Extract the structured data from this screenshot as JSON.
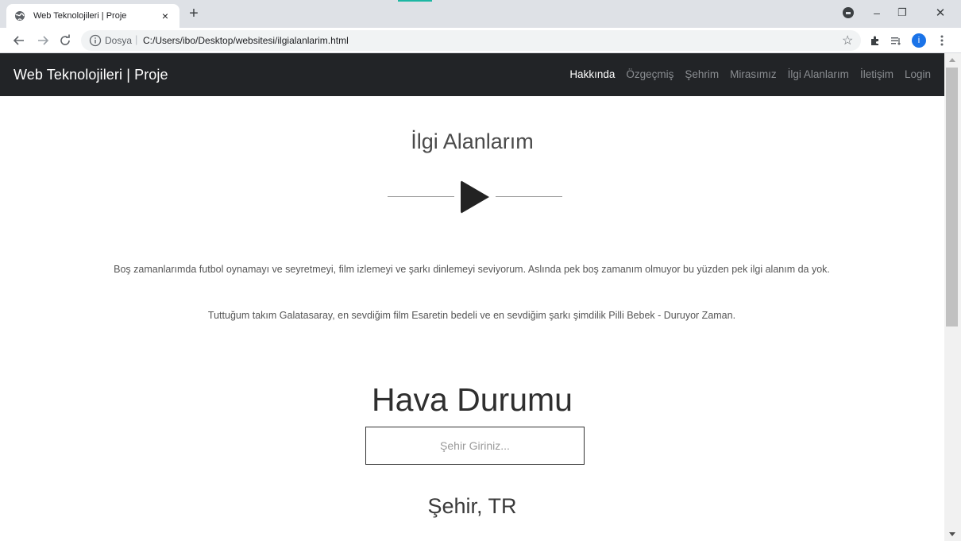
{
  "browser": {
    "tab_title": "Web Teknolojileri | Proje",
    "tab_close": "×",
    "new_tab": "+",
    "address": {
      "scheme_label": "Dosya",
      "separator": "|",
      "url": "C:/Users/ibo/Desktop/websitesi/ilgialanlarim.html"
    },
    "avatar_initial": "i",
    "window_controls": {
      "minimize": "–",
      "maximize": "❐",
      "close": "✕"
    }
  },
  "navbar": {
    "brand": "Web Teknolojileri | Proje",
    "links": [
      "Hakkında",
      "Özgeçmiş",
      "Şehrim",
      "Mirasımız",
      "İlgi Alanlarım",
      "İletişim",
      "Login"
    ],
    "active_index": 0
  },
  "content": {
    "section1_title": "İlgi Alanlarım",
    "paragraph1": "Boş zamanlarımda futbol oynamayı ve seyretmeyi, film izlemeyi ve şarkı dinlemeyi seviyorum. Aslında pek boş zamanım olmuyor bu yüzden pek ilgi alanım da yok.",
    "paragraph2": "Tuttuğum takım Galatasaray, en sevdiğim film Esaretin bedeli ve en sevdiğim şarkı şimdilik Pilli Bebek - Duruyor Zaman.",
    "weather_title": "Hava Durumu",
    "city_input": {
      "placeholder": "Şehir Giriniz...",
      "value": ""
    },
    "city_result": "Şehir, TR"
  },
  "colors": {
    "navbar_bg": "#222427",
    "nav_active": "#ffffff",
    "nav_inactive": "#8a8d91",
    "tabstrip_bg": "#dee1e6",
    "accent": "#1db7a3"
  },
  "icons": [
    "globe-icon",
    "back-arrow-icon",
    "forward-arrow-icon",
    "reload-icon",
    "info-icon",
    "star-icon",
    "extensions-icon",
    "reading-list-icon",
    "kebab-menu-icon",
    "play-icon",
    "profile-icon"
  ]
}
